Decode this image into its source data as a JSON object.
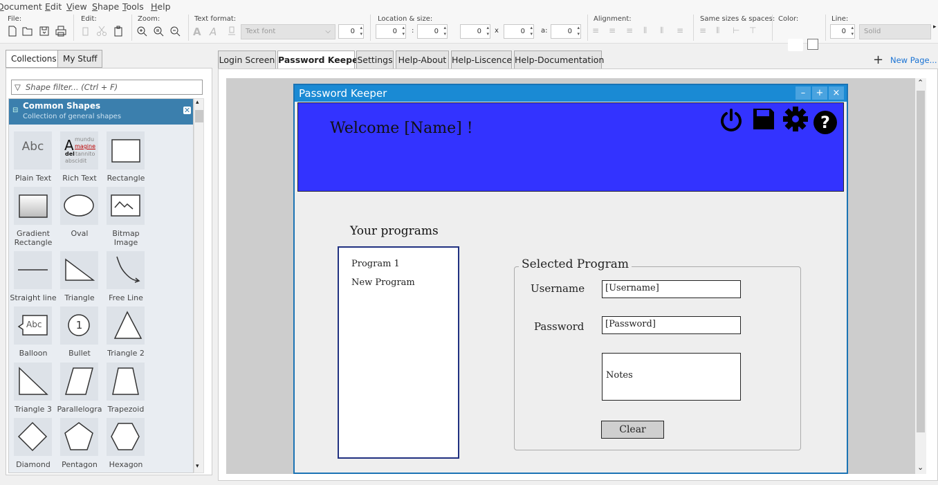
{
  "menu": {
    "items": [
      {
        "label": "Document",
        "ul": "D"
      },
      {
        "label": "Edit",
        "ul": "E"
      },
      {
        "label": "View",
        "ul": "V"
      },
      {
        "label": "Shape",
        "ul": "S"
      },
      {
        "label": "Tools",
        "ul": "T"
      },
      {
        "label": "Help",
        "ul": "H"
      }
    ]
  },
  "toolbar": {
    "file_label": "File:",
    "edit_label": "Edit:",
    "zoom_label": "Zoom:",
    "text_format_label": "Text format:",
    "location_size_label": "Location & size:",
    "alignment_label": "Alignment:",
    "same_sizes_label": "Same sizes & spaces:",
    "color_label": "Color:",
    "line_label": "Line:",
    "font_dropdown": "Text font",
    "font_size": "0",
    "loc_x": "0",
    "loc_colon": ":",
    "loc_y": "0",
    "size_w": "0",
    "size_x": "x",
    "size_h": "0",
    "angle_label": "a:",
    "angle": "0",
    "line_width": "0",
    "line_style": "Solid"
  },
  "left_tabs": [
    "Collections",
    "My Stuff"
  ],
  "shape_filter": {
    "placeholder": "Shape filter... (Ctrl + F)"
  },
  "library": {
    "title": "Common Shapes",
    "subtitle": "Collection of general shapes",
    "shapes": [
      {
        "label": "Plain Text",
        "icon": "plain-text-icon"
      },
      {
        "label": "Rich Text",
        "icon": "rich-text-icon"
      },
      {
        "label": "Rectangle",
        "icon": "rectangle-icon"
      },
      {
        "label": "Gradient Rectangle",
        "icon": "gradient-rectangle-icon"
      },
      {
        "label": "Oval",
        "icon": "oval-icon"
      },
      {
        "label": "Bitmap Image",
        "icon": "bitmap-image-icon"
      },
      {
        "label": "Straight line",
        "icon": "straight-line-icon"
      },
      {
        "label": "Triangle",
        "icon": "triangle-icon"
      },
      {
        "label": "Free Line",
        "icon": "free-line-icon"
      },
      {
        "label": "Balloon",
        "icon": "balloon-icon"
      },
      {
        "label": "Bullet",
        "icon": "bullet-icon"
      },
      {
        "label": "Triangle 2",
        "icon": "triangle-2-icon"
      },
      {
        "label": "Triangle 3",
        "icon": "triangle-3-icon"
      },
      {
        "label": "Parallelogra",
        "icon": "parallelogram-icon"
      },
      {
        "label": "Trapezoid",
        "icon": "trapezoid-icon"
      },
      {
        "label": "Diamond",
        "icon": "diamond-icon"
      },
      {
        "label": "Pentagon",
        "icon": "pentagon-icon"
      },
      {
        "label": "Hexagon",
        "icon": "hexagon-icon"
      }
    ],
    "plain_text_sample": "Abc",
    "rich_text_sample": {
      "big": "A",
      "l1": "mundu",
      "l2": "magine",
      "l3": "del",
      "l3b": "tannito",
      "l4": "abscidit"
    },
    "balloon_sample": "Abc",
    "bullet_sample": "1"
  },
  "page_tabs": [
    {
      "label": "Login Screen",
      "active": false
    },
    {
      "label": "Password Keeper",
      "active": true
    },
    {
      "label": "Settings",
      "active": false
    },
    {
      "label": "Help-About",
      "active": false
    },
    {
      "label": "Help-Liscence",
      "active": false
    },
    {
      "label": "Help-Documentation",
      "active": false
    }
  ],
  "new_page": {
    "plus": "+",
    "label": "New Page..."
  },
  "mockup": {
    "window_title": "Password Keeper",
    "window_buttons": [
      "–",
      "+",
      "×"
    ],
    "banner_color": "#3333ff",
    "welcome": "Welcome [Name] !",
    "banner_icons": [
      "power-icon",
      "save-icon",
      "gear-icon",
      "help-icon"
    ],
    "help_glyph": "?",
    "programs_title": "Your programs",
    "programs": [
      "Program 1",
      "New Program"
    ],
    "selected_program_legend": "Selected Program",
    "username_label": "Username",
    "username_value": "[Username]",
    "password_label": "Password",
    "password_value": "[Password]",
    "notes_value": "Notes",
    "clear_button": "Clear"
  },
  "colors": {
    "accent": "#1a8ad4",
    "library_header": "#3b7fad",
    "new_page_link": "#1a73d4"
  }
}
